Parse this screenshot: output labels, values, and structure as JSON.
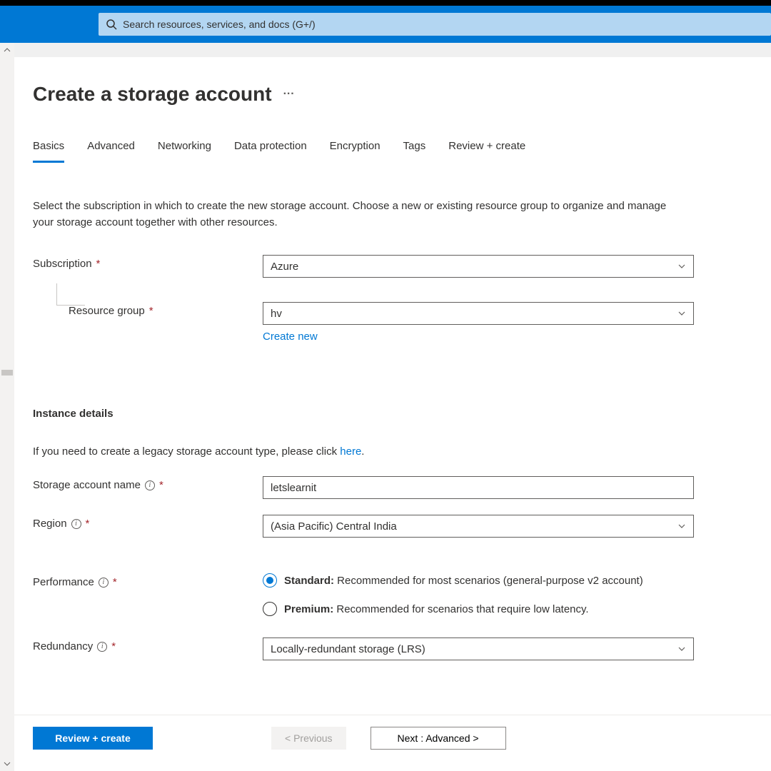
{
  "search": {
    "placeholder": "Search resources, services, and docs (G+/)"
  },
  "header": {
    "title": "Create a storage account"
  },
  "tabs": [
    "Basics",
    "Advanced",
    "Networking",
    "Data protection",
    "Encryption",
    "Tags",
    "Review + create"
  ],
  "intro": "Select the subscription in which to create the new storage account. Choose a new or existing resource group to organize and manage your storage account together with other resources.",
  "fields": {
    "subscription": {
      "label": "Subscription",
      "value": "Azure"
    },
    "resource_group": {
      "label": "Resource group",
      "value": "hv",
      "create_new": "Create new"
    },
    "instance_heading": "Instance details",
    "legacy_text_pre": "If you need to create a legacy storage account type, please click ",
    "legacy_link": "here",
    "storage_name": {
      "label": "Storage account name",
      "value": "letslearnit"
    },
    "region": {
      "label": "Region",
      "value": "(Asia Pacific) Central India"
    },
    "performance": {
      "label": "Performance",
      "options": {
        "standard": {
          "title": "Standard:",
          "desc": " Recommended for most scenarios (general-purpose v2 account)",
          "selected": true
        },
        "premium": {
          "title": "Premium:",
          "desc": " Recommended for scenarios that require low latency.",
          "selected": false
        }
      }
    },
    "redundancy": {
      "label": "Redundancy",
      "value": "Locally-redundant storage (LRS)"
    }
  },
  "footer": {
    "review": "Review + create",
    "previous": "< Previous",
    "next": "Next : Advanced >"
  }
}
